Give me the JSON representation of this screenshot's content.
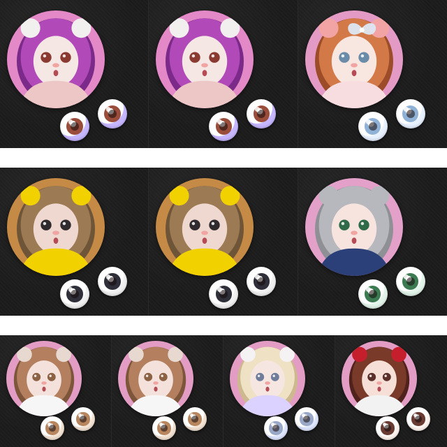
{
  "rows": [
    {
      "tiles": [
        {
          "background": "#e489c7",
          "doll": {
            "hair": "#b14ab8",
            "hair_dark": "#7c2a89",
            "skin": "#f4e7e4",
            "outfit": "#ecc7c6",
            "ears": "#f2f0ef",
            "iris_color": "#8a3a30"
          },
          "eyes": {
            "sclera": "#ffffff",
            "rim": "#c6b6ff",
            "iris": "#9a4d3b"
          }
        },
        {
          "background": "#e489c7",
          "doll": {
            "hair": "#b14ab8",
            "hair_dark": "#7c2a89",
            "skin": "#f4e7e4",
            "outfit": "#ecc7c6",
            "ears": "#f2f0ef",
            "iris_color": "#8a3a30"
          },
          "eyes": {
            "sclera": "#ffffff",
            "rim": "#c6b6ff",
            "iris": "#9a4d3b"
          }
        },
        {
          "background": "#e39bc6",
          "doll": {
            "hair": "#d27947",
            "hair_dark": "#9c4c28",
            "skin": "#f8e6e0",
            "outfit": "#f8dde0",
            "ears": "#f2a4a4",
            "iris_color": "#6a8ca8",
            "bow": "#dce7f3"
          },
          "eyes": {
            "sclera": "#ffffff",
            "rim": "#e8f1ff",
            "iris": "#8fb2d6"
          }
        }
      ]
    },
    {
      "tiles": [
        {
          "background": "#c48a46",
          "doll": {
            "hair": "#9c7a54",
            "hair_dark": "#6f5538",
            "skin": "#efd8cf",
            "outfit": "#f2d100",
            "ears": "#f2d100",
            "iris_color": "#2f2a2e"
          },
          "eyes": {
            "sclera": "#ffffff",
            "rim": "#f0f0f0",
            "iris": "#2f2f3a"
          }
        },
        {
          "background": "#c48a46",
          "doll": {
            "hair": "#9c7a54",
            "hair_dark": "#6f5538",
            "skin": "#efd8cf",
            "outfit": "#f2d100",
            "ears": "#f2d100",
            "iris_color": "#2f2a2e"
          },
          "eyes": {
            "sclera": "#ffffff",
            "rim": "#f0f0f0",
            "iris": "#2f2f3a"
          }
        },
        {
          "background": "#e3a0c8",
          "doll": {
            "hair": "#b7b8be",
            "hair_dark": "#8f9096",
            "skin": "#f7e4df",
            "outfit": "#2b3f79",
            "ears": "#b7b8be",
            "iris_color": "#2f6a49"
          },
          "eyes": {
            "sclera": "#ffffff",
            "rim": "#e3f5ea",
            "iris": "#3c7a52"
          }
        }
      ]
    },
    {
      "tiles": [
        {
          "background": "#e39cc4",
          "doll": {
            "hair": "#b37f5f",
            "hair_dark": "#7c553b",
            "skin": "#f5e1db",
            "outfit": "#f6f6f6",
            "ears": "#e8d9d0",
            "iris_color": "#8b6244"
          },
          "eyes": {
            "sclera": "#ffffff",
            "rim": "#f3e3d4",
            "iris": "#b8865e"
          }
        },
        {
          "background": "#e39cc4",
          "doll": {
            "hair": "#b37f5f",
            "hair_dark": "#7c553b",
            "skin": "#f5e1db",
            "outfit": "#f6f6f6",
            "ears": "#e8d9d0",
            "iris_color": "#8b6244"
          },
          "eyes": {
            "sclera": "#ffffff",
            "rim": "#f3e3d4",
            "iris": "#b8865e"
          }
        },
        {
          "background": "#e39cc4",
          "doll": {
            "hair": "#efe2c4",
            "hair_dark": "#cdb88f",
            "skin": "#f6e6e2",
            "outfit": "#dcd2ff",
            "ears": "#f4f2f2",
            "iris_color": "#6f7c9a"
          },
          "eyes": {
            "sclera": "#ffffff",
            "rim": "#dfe7ff",
            "iris": "#9aa8c7"
          }
        },
        {
          "background": "#e39cc4",
          "doll": {
            "hair": "#7a3a2a",
            "hair_dark": "#4f231b",
            "skin": "#f5dfd6",
            "outfit": "#f2f2f2",
            "ears": "#c51f2d",
            "iris_color": "#5b2f2a"
          },
          "eyes": {
            "sclera": "#ffffff",
            "rim": "#fff4ef",
            "iris": "#6a3b33"
          }
        }
      ]
    }
  ]
}
